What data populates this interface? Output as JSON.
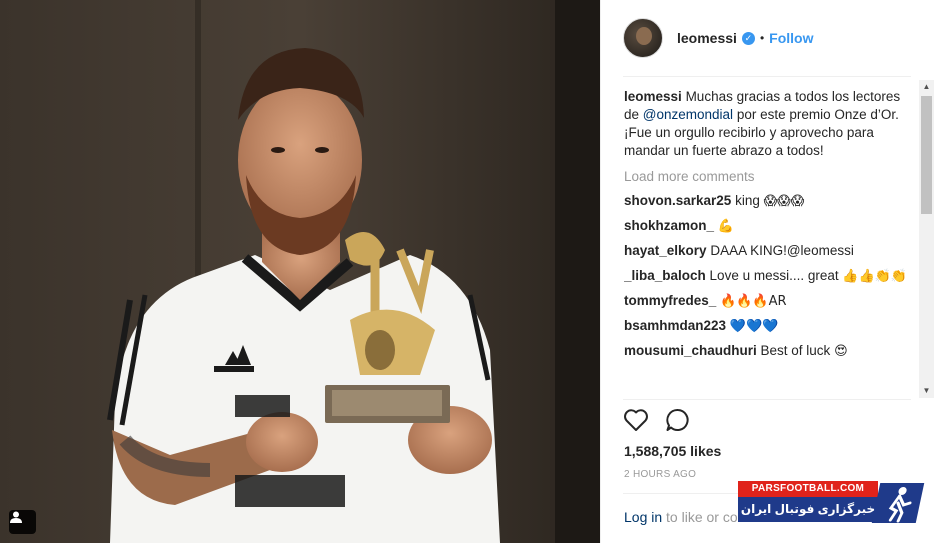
{
  "post": {
    "username": "leomessi",
    "follow_label": "Follow",
    "dot": "•",
    "caption_user": "leomessi",
    "caption_part1": "Muchas gracias a todos los lectores de",
    "caption_mention": "@onzemondial",
    "caption_part2": "por este premio Onze d’Or. ¡Fue un orgullo recibirlo y aprovecho para mandar un fuerte abrazo a todos!",
    "load_more": "Load more comments",
    "likes": "1,588,705 likes",
    "timestamp": "2 HOURS AGO",
    "login_link": "Log in",
    "login_rest": "to like or co"
  },
  "comments": [
    {
      "user": "shovon.sarkar25",
      "text": "king",
      "emoji": "😱😱😱"
    },
    {
      "user": "shokhzamon_",
      "text": "",
      "emoji": "💪"
    },
    {
      "user": "hayat_elkory",
      "text": "DAAA KING!@leomessi",
      "emoji": ""
    },
    {
      "user": "_liba_baloch",
      "text": "Love u messi.... great",
      "emoji": "👍👍👏👏"
    },
    {
      "user": "tommyfredes_",
      "text": "",
      "emoji": "🔥🔥🔥AR"
    },
    {
      "user": "bsamhmdan223",
      "text": "",
      "emoji": "💙💙💙"
    },
    {
      "user": "mousumi_chaudhuri",
      "text": "Best of luck",
      "emoji": "😍"
    }
  ],
  "icons": {
    "like": "heart-outline-icon",
    "comment": "speech-bubble-icon",
    "tag": "user-tag-icon",
    "verified": "verified-badge-icon"
  },
  "watermark": {
    "top": "PARSFOOTBALL.COM",
    "bottom": "خبرگزاری فوتبال ایران"
  },
  "colors": {
    "accent": "#3897f0",
    "mention": "#003569",
    "muted": "#999999"
  }
}
